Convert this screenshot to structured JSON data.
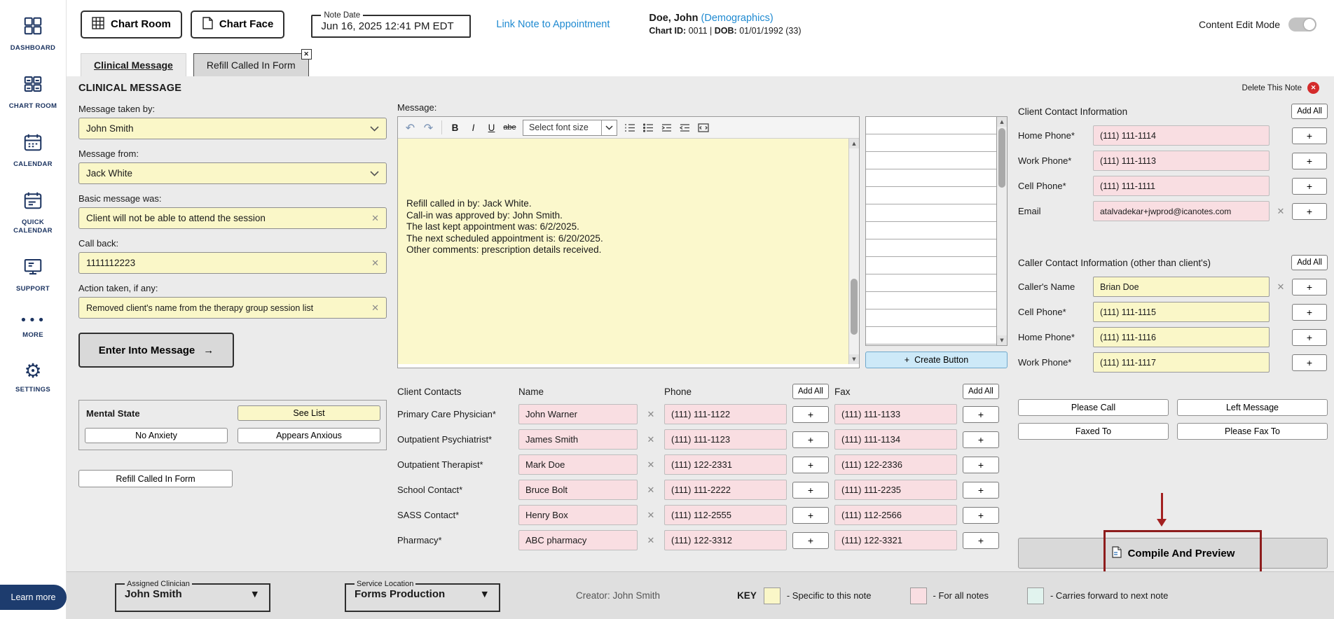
{
  "icons": {
    "close": "✕",
    "plus": "+",
    "arrow_right": "→",
    "caret_down": "▼",
    "scroll_up": "▲",
    "scroll_down": "▼",
    "gear": "⚙",
    "more_dots": "•••",
    "undo": "↶",
    "redo": "↷",
    "delete_x": "✕"
  },
  "colors": {
    "note_yellow": "#faf7c8",
    "all_notes_pink": "#f9dee2",
    "carry_forward_teal": "#e1f3ee",
    "link_blue": "#1f8ad1",
    "highlight_red": "#8e1d1d",
    "navy": "#1c3461"
  },
  "sidebar": {
    "items": [
      {
        "label": "DASHBOARD"
      },
      {
        "label": "CHART ROOM"
      },
      {
        "label": "CALENDAR"
      },
      {
        "label": "QUICK CALENDAR"
      },
      {
        "label": "SUPPORT"
      },
      {
        "label": "MORE"
      },
      {
        "label": "SETTINGS"
      }
    ],
    "learn_more": "Learn more"
  },
  "topbar": {
    "chart_room": "Chart Room",
    "chart_face": "Chart Face",
    "note_date_label": "Note Date",
    "note_date_value": "Jun 16, 2025 12:41 PM EDT",
    "link_note": "Link Note to Appointment",
    "patient_name": "Doe, John",
    "demographics": "(Demographics)",
    "chart_id_label": "Chart ID:",
    "chart_id_value": "0011",
    "sep": "|",
    "dob_label": "DOB:",
    "dob_value": "01/01/1992 (33)",
    "content_edit_mode": "Content Edit Mode"
  },
  "tabs": {
    "items": [
      {
        "label": "Clinical Message"
      },
      {
        "label": "Refill Called In Form"
      }
    ]
  },
  "note": {
    "title": "CLINICAL MESSAGE",
    "delete_label": "Delete This Note"
  },
  "form": {
    "taken_by_label": "Message taken by:",
    "taken_by_value": "John Smith",
    "from_label": "Message from:",
    "from_value": "Jack White",
    "basic_label": "Basic message was:",
    "basic_value": "Client will not be able to attend the session",
    "callback_label": "Call back:",
    "callback_value": "1111112223",
    "action_label": "Action taken, if any:",
    "action_value": "Removed client's name from the therapy group session list",
    "enter_button": "Enter Into Message",
    "mental_state": {
      "label": "Mental State",
      "see_list": "See List",
      "option1": "No Anxiety",
      "option2": "Appears Anxious"
    },
    "refill_button": "Refill Called In Form"
  },
  "editor": {
    "label": "Message:",
    "toolbar": {
      "bold": "B",
      "italic": "I",
      "underline": "U",
      "strike": "abe",
      "font_size_placeholder": "Select font size"
    },
    "lines": [
      "Refill called in by: Jack White.",
      "Call-in was approved by: John Smith.",
      "The last kept appointment was: 6/2/2025.",
      "The next scheduled appointment is: 6/20/2025.",
      "Other comments: prescription details received."
    ],
    "create_button": "Create Button"
  },
  "contacts": {
    "header_label": "Client Contacts",
    "header_name": "Name",
    "header_phone": "Phone",
    "header_fax": "Fax",
    "add_all": "Add All",
    "rows": [
      {
        "label": "Primary Care Physician*",
        "name": "John Warner",
        "phone": "(111) 111-1122",
        "fax": "(111) 111-1133"
      },
      {
        "label": "Outpatient Psychiatrist*",
        "name": "James Smith",
        "phone": "(111) 111-1123",
        "fax": "(111) 111-1134"
      },
      {
        "label": "Outpatient Therapist*",
        "name": "Mark Doe",
        "phone": "(111) 122-2331",
        "fax": "(111) 122-2336"
      },
      {
        "label": "School Contact*",
        "name": "Bruce Bolt",
        "phone": "(111) 111-2222",
        "fax": "(111) 111-2235"
      },
      {
        "label": "SASS Contact*",
        "name": "Henry Box",
        "phone": "(111) 112-2555",
        "fax": "(111) 112-2566"
      },
      {
        "label": "Pharmacy*",
        "name": "ABC pharmacy",
        "phone": "(111) 122-3312",
        "fax": "(111) 122-3321"
      }
    ]
  },
  "client_info": {
    "title": "Client Contact Information",
    "add_all": "Add All",
    "rows": [
      {
        "label": "Home Phone*",
        "value": "(111) 111-1114"
      },
      {
        "label": "Work Phone*",
        "value": "(111) 111-1113"
      },
      {
        "label": "Cell Phone*",
        "value": "(111) 111-1111"
      },
      {
        "label": "Email",
        "value": "atalvadekar+jwprod@icanotes.com"
      }
    ]
  },
  "caller_info": {
    "title": "Caller Contact Information (other than client's)",
    "add_all": "Add All",
    "rows": [
      {
        "label": "Caller's Name",
        "value": "Brian Doe"
      },
      {
        "label": "Cell Phone*",
        "value": "(111) 111-1115"
      },
      {
        "label": "Home Phone*",
        "value": "(111) 111-1116"
      },
      {
        "label": "Work Phone*",
        "value": "(111) 111-1117"
      }
    ]
  },
  "actions": {
    "please_call": "Please Call",
    "left_message": "Left Message",
    "faxed_to": "Faxed To",
    "please_fax_to": "Please Fax To",
    "compile": "Compile And Preview"
  },
  "footer": {
    "assigned_clinician_label": "Assigned Clinician",
    "assigned_clinician_value": "John Smith",
    "service_location_label": "Service Location",
    "service_location_value": "Forms Production",
    "creator": "Creator: John Smith",
    "key_label": "KEY",
    "key1": "- Specific to this note",
    "key2": "- For all notes",
    "key3": "- Carries forward to next note"
  }
}
